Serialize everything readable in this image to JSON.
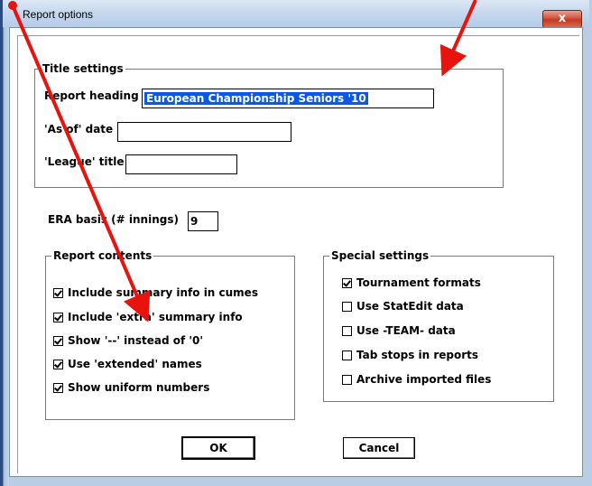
{
  "window": {
    "title": "Report options",
    "close_label": "x"
  },
  "title_settings": {
    "group_label": "Title settings",
    "report_heading_label": "Report heading",
    "report_heading_value": "European Championship Seniors '10",
    "as_of_label": "'As of' date",
    "as_of_value": "",
    "league_label": "'League' title",
    "league_value": ""
  },
  "era": {
    "label": "ERA basis (# innings)",
    "value": "9"
  },
  "report_contents": {
    "group_label": "Report contents",
    "items": [
      {
        "label": "Include summary info in cumes",
        "checked": true
      },
      {
        "label": "Include 'extra' summary info",
        "checked": true
      },
      {
        "label": "Show '--' instead of '0'",
        "checked": true
      },
      {
        "label": "Use 'extended' names",
        "checked": true
      },
      {
        "label": "Show uniform numbers",
        "checked": true
      }
    ]
  },
  "special_settings": {
    "group_label": "Special settings",
    "items": [
      {
        "label": "Tournament formats",
        "checked": true
      },
      {
        "label": "Use StatEdit data",
        "checked": false
      },
      {
        "label": "Use -TEAM- data",
        "checked": false
      },
      {
        "label": "Tab stops in reports",
        "checked": false
      },
      {
        "label": "Archive imported files",
        "checked": false
      }
    ]
  },
  "buttons": {
    "ok": "OK",
    "cancel": "Cancel"
  },
  "annotation_color": "#e8130c"
}
